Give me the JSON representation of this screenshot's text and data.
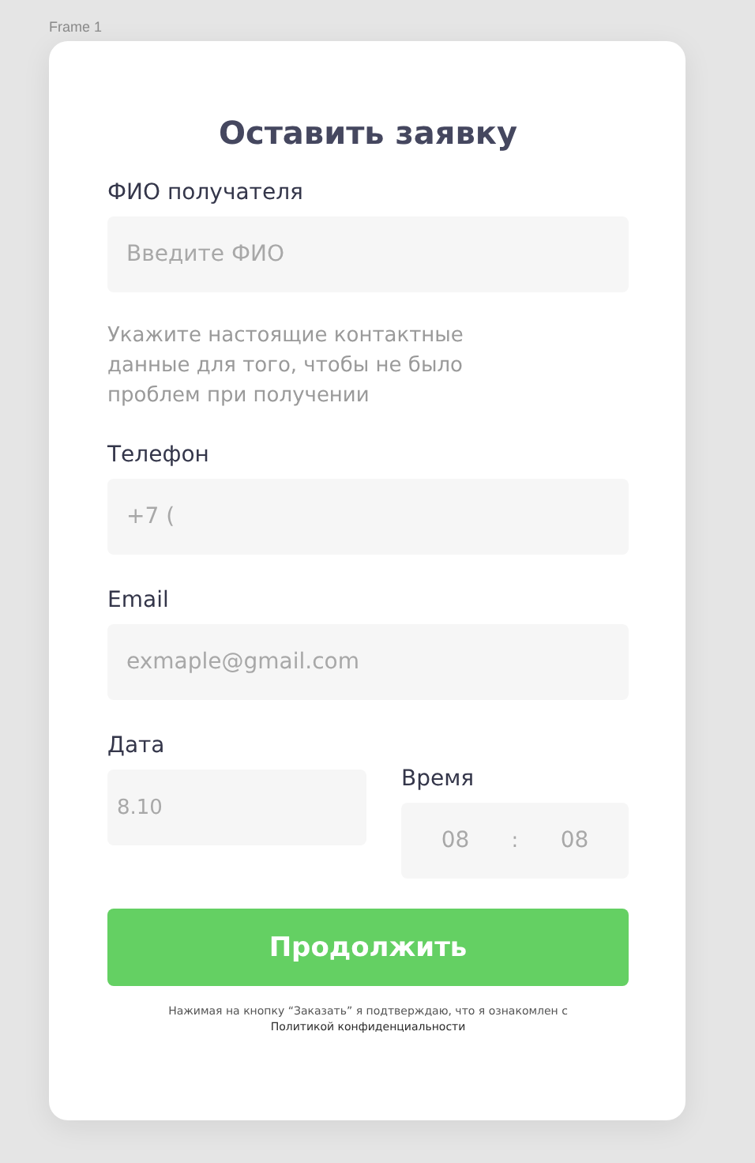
{
  "frame_label": "Frame 1",
  "title": "Оставить заявку",
  "name_field": {
    "label": "ФИО получателя",
    "placeholder": "Введите ФИО"
  },
  "hint": "Укажите настоящие контактные данные для того, чтобы не было проблем при получении",
  "phone_field": {
    "label": "Телефон",
    "value": "+7 ("
  },
  "email_field": {
    "label": "Email",
    "placeholder": "exmaple@gmail.com"
  },
  "date_field": {
    "label": "Дата",
    "value": "8.10"
  },
  "time_field": {
    "label": "Время",
    "hours": "08",
    "separator": ":",
    "minutes": "08"
  },
  "submit_button": "Продолжить",
  "consent": {
    "text": "Нажимая на кнопку “Заказать” я подтверждаю, что я ознакомлен с",
    "link": "Политикой конфиденциальности"
  }
}
